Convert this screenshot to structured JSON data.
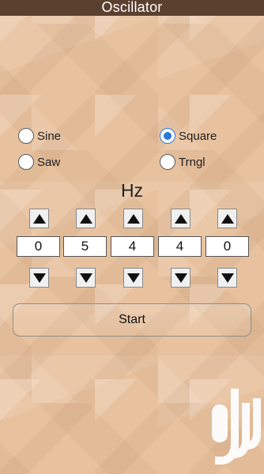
{
  "app": {
    "title": "Oscillator"
  },
  "waveforms": {
    "options": [
      {
        "label": "Sine",
        "selected": false
      },
      {
        "label": "Square",
        "selected": true
      },
      {
        "label": "Saw",
        "selected": false
      },
      {
        "label": "Trngl",
        "selected": false
      }
    ]
  },
  "frequency": {
    "unit_label": "Hz",
    "digits": [
      "0",
      "5",
      "4",
      "4",
      "0"
    ]
  },
  "controls": {
    "start_label": "Start"
  },
  "icons": {
    "up": "triangle-up-icon",
    "down": "triangle-down-icon",
    "watermark": "bazaar-logo-watermark"
  },
  "colors": {
    "accent": "#2a78d4",
    "background": "#e8c29f",
    "titlebar": "#5b4030"
  }
}
